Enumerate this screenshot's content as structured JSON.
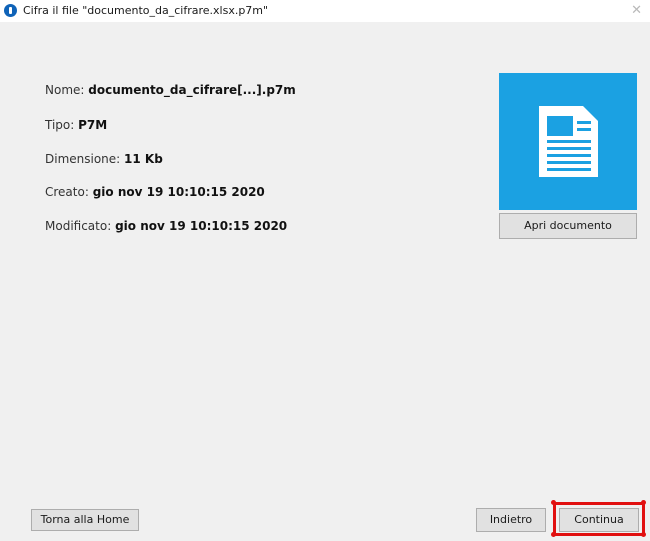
{
  "window": {
    "title": "Cifra il file \"documento_da_cifrare.xlsx.p7m\"",
    "close_glyph": "✕",
    "icon": "app-info-icon"
  },
  "file_info": {
    "name_label": "Nome:",
    "name_value": "documento_da_cifrare[...].p7m",
    "type_label": "Tipo:",
    "type_value": "P7M",
    "size_label": "Dimensione:",
    "size_value": "11 Kb",
    "created_label": "Creato:",
    "created_value": "gio nov 19 10:10:15 2020",
    "modified_label": "Modificato:",
    "modified_value": "gio nov 19 10:10:15 2020"
  },
  "preview": {
    "icon": "document-icon",
    "tile_color": "#1ba1e2",
    "open_button": "Apri documento"
  },
  "footer": {
    "home_button": "Torna alla Home",
    "back_button": "Indietro",
    "continue_button": "Continua",
    "highlight_color": "#e11010"
  }
}
